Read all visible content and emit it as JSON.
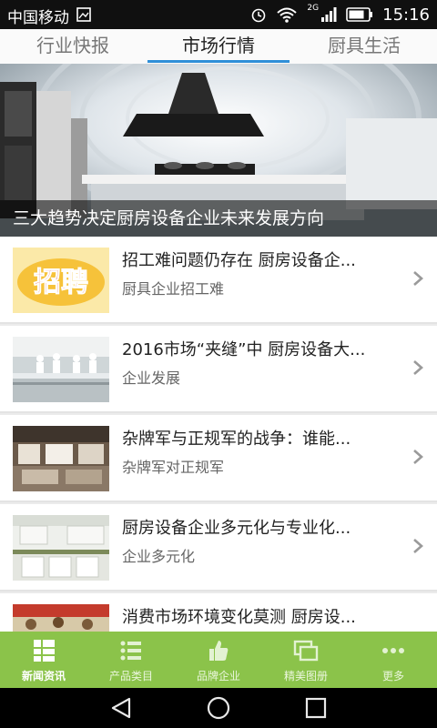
{
  "status_bar": {
    "carrier": "中国移动",
    "network": "2G",
    "time": "15:16",
    "icons": [
      "image-icon",
      "alarm-icon",
      "wifi-icon",
      "signal-icon",
      "battery-icon"
    ]
  },
  "tabs": [
    {
      "label": "行业快报",
      "active": false
    },
    {
      "label": "市场行情",
      "active": true
    },
    {
      "label": "厨具生活",
      "active": false
    }
  ],
  "banner": {
    "caption": "三大趋势决定厨房设备企业未来发展方向"
  },
  "articles": [
    {
      "title": "招工难问题仍存在 厨房设备企...",
      "subtitle": "厨具企业招工难",
      "thumb_text": "招聘"
    },
    {
      "title": "2016市场“夹缝”中 厨房设备大...",
      "subtitle": "企业发展"
    },
    {
      "title": "杂牌军与正规军的战争：谁能...",
      "subtitle": "杂牌军对正规军"
    },
    {
      "title": "厨房设备企业多元化与专业化...",
      "subtitle": "企业多元化"
    },
    {
      "title": "消费市场环境变化莫测 厨房设...",
      "subtitle": ""
    }
  ],
  "bottom_nav": [
    {
      "label": "新闻资讯",
      "icon": "grid-list-icon",
      "active": true
    },
    {
      "label": "产品类目",
      "icon": "list-icon",
      "active": false
    },
    {
      "label": "品牌企业",
      "icon": "thumbs-up-icon",
      "active": false
    },
    {
      "label": "精美图册",
      "icon": "gallery-icon",
      "active": false
    },
    {
      "label": "更多",
      "icon": "more-icon",
      "active": false
    }
  ],
  "system_nav": [
    "back-icon",
    "home-icon",
    "recents-icon"
  ],
  "colors": {
    "accent": "#2f8fd8",
    "nav_bg": "#8bc34a"
  }
}
